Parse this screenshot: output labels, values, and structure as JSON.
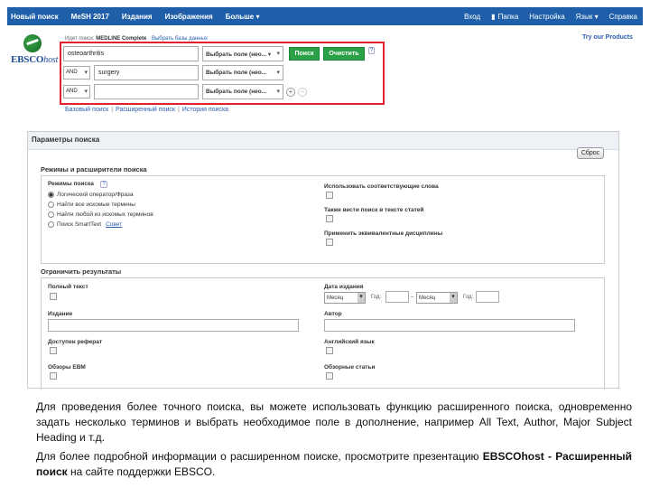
{
  "topbar": {
    "left": [
      "Новый поиск",
      "MeSH 2017",
      "Издания",
      "Изображения",
      "Больше ▾"
    ],
    "right": [
      "Вход",
      "Папка",
      "Настройка",
      "Язык ▾",
      "Справка"
    ]
  },
  "logo": {
    "brand": "EBSCO",
    "brand_suffix": "host"
  },
  "search": {
    "db_prefix": "Идет поиск:",
    "db_name": "MEDLINE Complete",
    "db_change": "Выбрать базы данных",
    "rows": [
      {
        "bool": "",
        "term": "osteoarthritis",
        "field": "Выбрать поле (нео... ▾"
      },
      {
        "bool": "AND",
        "term": "surgery",
        "field": "Выбрать поле (нео..."
      },
      {
        "bool": "AND",
        "term": "",
        "field": "Выбрать поле (нео..."
      }
    ],
    "search_button": "Поиск",
    "clear_button": "Очистить",
    "help": "?",
    "add": "+",
    "remove": "−"
  },
  "sublinks": [
    "Базовый поиск",
    "Расширенный поиск",
    "История поиска"
  ],
  "try_link": "Try our Products",
  "params": {
    "title": "Параметры поиска",
    "close": "Сброс",
    "modes_title": "Режимы и расширители поиска",
    "modes_label": "Режимы поиска",
    "modes_help": "?",
    "modes": [
      {
        "label": "Логический оператор/Фраза",
        "selected": true
      },
      {
        "label": "Найти все искомые термины",
        "selected": false
      },
      {
        "label": "Найти любой из искомых терминов",
        "selected": false
      },
      {
        "label": "Поиск SmartText",
        "selected": false,
        "hint": "Совет"
      }
    ],
    "expanders": [
      "Использовать соответствующие слова",
      "Также вести поиск в тексте статей",
      "Применить эквивалентные дисциплины"
    ],
    "limit_title": "Ограничить результаты",
    "full_text": "Полный текст",
    "pub_date": "Дата издания",
    "month": "Месяц",
    "year": "Год:",
    "dash": "–",
    "edition": "Издание",
    "author": "Автор",
    "abstract": "Доступен реферат",
    "english": "Английский язык",
    "ebm": "Обзоры EBM",
    "reviews": "Обзорные статьи"
  },
  "caption": {
    "p1": "Для проведения более точного поиска, вы можете использовать функцию расширенного поиска, одновременно задать несколько терминов и выбрать необходимое поле в дополнение, например All Text, Author, Major Subject Heading и т.д.",
    "p2_start": "Для более подробной информации о расширенном поиске, просмотрите презентацию",
    "p2_bold": "EBSCOhost - Расширенный поиск",
    "p2_end": "на сайте поддержки EBSCO."
  }
}
